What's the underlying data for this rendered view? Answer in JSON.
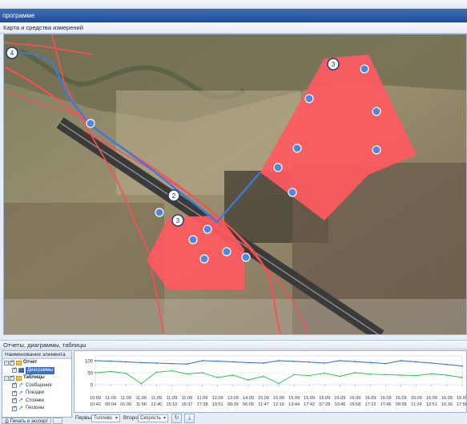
{
  "window": {
    "title": "программе"
  },
  "map_panel": {
    "title": "Карта и средства измерений",
    "markers": [
      "4",
      "3",
      "2",
      "3"
    ],
    "zoom": {
      "minus": "−",
      "plus": "+",
      "level": 0.75
    }
  },
  "reports_panel": {
    "title": "Отчеты, диаграммы, таблицы",
    "tree": {
      "header": "Наименование элемента",
      "items": [
        {
          "label": "Отчет",
          "level": 0,
          "expander": "−",
          "icon": "folder-icon"
        },
        {
          "label": "Диаграммы",
          "level": 1,
          "icon": "chart-icon",
          "selected": true
        },
        {
          "label": "Таблицы",
          "level": 0,
          "expander": "−",
          "icon": "folder-icon"
        },
        {
          "label": "Сообщения",
          "level": 1,
          "icon": "arrow-icon"
        },
        {
          "label": "Поездки",
          "level": 1,
          "icon": "arrow-icon"
        },
        {
          "label": "Стоянки",
          "level": 1,
          "icon": "arrow-icon"
        },
        {
          "label": "Геозоны",
          "level": 1,
          "icon": "arrow-icon"
        }
      ]
    },
    "print_button": "Печать и экспорт"
  },
  "chart_data": {
    "type": "line",
    "y_ticks": [
      "100",
      "50",
      "0"
    ],
    "ylim": [
      0,
      120
    ],
    "x_ticks": [
      {
        "date": "10.09",
        "time": "10:42"
      },
      {
        "date": "11.09",
        "time": "00:04"
      },
      {
        "date": "11.09",
        "time": "01:00"
      },
      {
        "date": "11.09",
        "time": "11:56"
      },
      {
        "date": "11.09",
        "time": "12:40"
      },
      {
        "date": "11.09",
        "time": "15:10"
      },
      {
        "date": "11.09",
        "time": "16:37"
      },
      {
        "date": "11.09",
        "time": "17:38"
      },
      {
        "date": "12.09",
        "time": "10:51"
      },
      {
        "date": "13.09",
        "time": "09:39"
      },
      {
        "date": "14.09",
        "time": "06:09"
      },
      {
        "date": "15.09",
        "time": "11:47"
      },
      {
        "date": "15.09",
        "time": "12:16"
      },
      {
        "date": "15.09",
        "time": "13:44"
      },
      {
        "date": "15.09",
        "time": "17:42"
      },
      {
        "date": "16.09",
        "time": "07:28"
      },
      {
        "date": "16.09",
        "time": "10:46"
      },
      {
        "date": "16.09",
        "time": "16:58"
      },
      {
        "date": "16.09",
        "time": "17:22"
      },
      {
        "date": "16.09",
        "time": "17:46"
      },
      {
        "date": "16.09",
        "time": "09:38"
      },
      {
        "date": "16.09",
        "time": "11:24"
      },
      {
        "date": "16.09",
        "time": "12:51"
      },
      {
        "date": "16.09",
        "time": "16:16"
      },
      {
        "date": "16.09",
        "time": "17:58"
      }
    ],
    "series": [
      {
        "name": "Топливо",
        "color": "#2f6dc6",
        "values": [
          100,
          98,
          95,
          92,
          90,
          88,
          86,
          100,
          98,
          95,
          92,
          90,
          100,
          97,
          94,
          90,
          100,
          96,
          92,
          88,
          100,
          95,
          90,
          84,
          78
        ]
      },
      {
        "name": "Скорость",
        "color": "#2bbf47",
        "values": [
          50,
          55,
          48,
          5,
          52,
          58,
          45,
          50,
          30,
          40,
          20,
          35,
          5,
          42,
          38,
          48,
          35,
          50,
          44,
          42,
          40,
          38,
          45,
          40,
          30
        ]
      }
    ]
  },
  "chart_controls": {
    "first_label": "Первый",
    "first_value": "Топливо",
    "second_label": "Второй",
    "second_value": "Скорость"
  },
  "colors": {
    "zone_fill": "#ff5a5f",
    "track_red": "#ff4d55",
    "track_blue": "#3b7be0",
    "titlebar": "#2a5aa3"
  }
}
